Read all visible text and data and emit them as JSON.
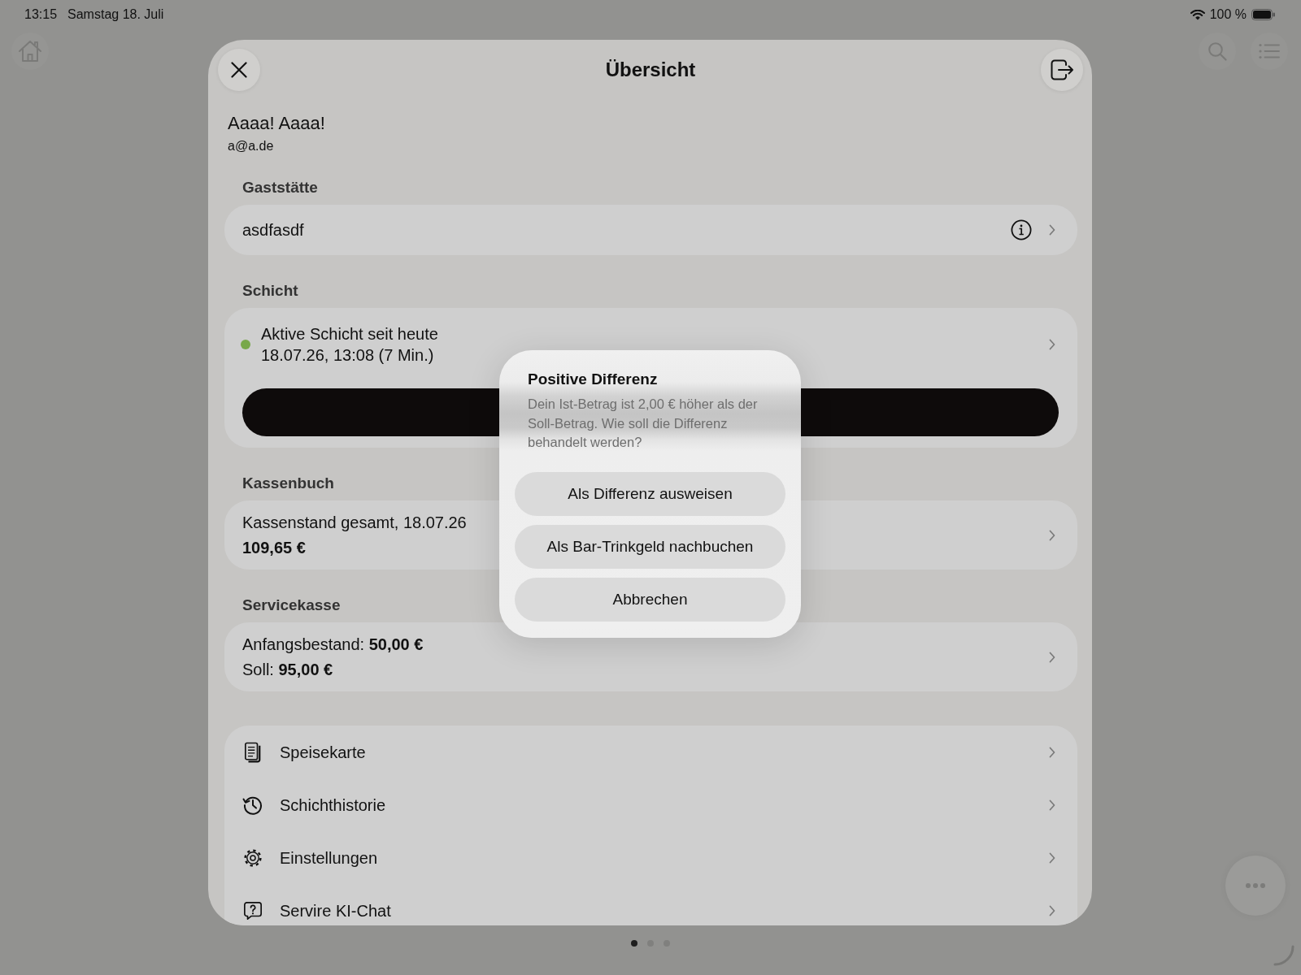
{
  "status_bar": {
    "time": "13:15",
    "date": "Samstag 18. Juli",
    "battery": "100 %"
  },
  "sheet": {
    "title": "Übersicht",
    "user": {
      "name": "Aaaa! Aaaa!",
      "email": "a@a.de"
    },
    "venue": {
      "header": "Gaststätte",
      "name": "asdfasdf"
    },
    "shift": {
      "header": "Schicht",
      "active": true,
      "status": "Aktive Schicht seit heute",
      "since": "18.07.26, 13:08 (7 Min.)"
    },
    "cash_book": {
      "header": "Kassenbuch",
      "label": "Kassenstand gesamt, 18.07.26",
      "amount": "109,65 €"
    },
    "service_cash": {
      "header": "Servicekasse",
      "lines": [
        "Anfangsbestand: **50,00 €**",
        "Soll: **95,00 €**"
      ]
    },
    "menu": [
      "Speisekarte",
      "Schichthistorie",
      "Einstellungen",
      "Servire KI-Chat"
    ]
  },
  "pager": [
    {
      "selected": true
    },
    {
      "selected": false
    },
    {
      "selected": false
    }
  ],
  "dialog": {
    "title": "Positive Differenz",
    "message": "Dein Ist-Betrag ist 2,00 € höher als der Soll-Betrag. Wie soll die Differenz behandelt werden?",
    "buttons": [
      "Als Differenz ausweisen",
      "Als Bar-Trinkgeld nachbuchen",
      "Abbrechen"
    ]
  }
}
